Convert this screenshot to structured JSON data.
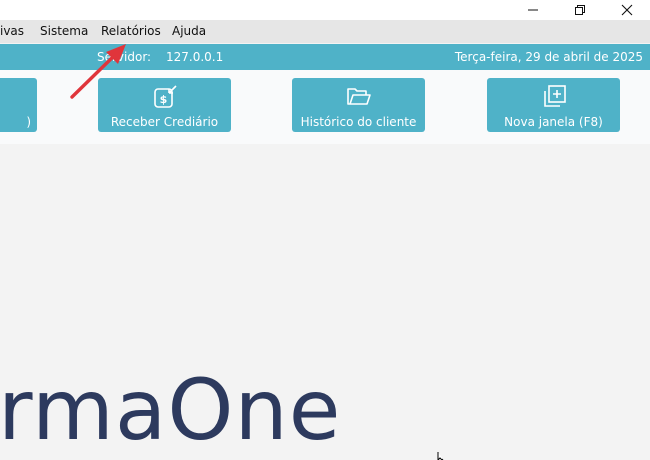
{
  "window": {
    "controls": [
      {
        "name": "minimize",
        "glyph": "—"
      },
      {
        "name": "maximize",
        "glyph": "❐"
      },
      {
        "name": "close",
        "glyph": "✕"
      }
    ]
  },
  "menubar": {
    "items": [
      {
        "label": "ivas"
      },
      {
        "label": "Sistema"
      },
      {
        "label": "Relatórios"
      },
      {
        "label": "Ajuda"
      }
    ]
  },
  "status": {
    "server_label": "Servidor:",
    "server_value": "127.0.0.1",
    "date": "Terça-feira, 29 de abril de 2025"
  },
  "toolbar": {
    "buttons": [
      {
        "label": ")",
        "icon": "unknown-icon"
      },
      {
        "label": "Receber Crediário",
        "icon": "receive-money-icon"
      },
      {
        "label": "Histórico do cliente",
        "icon": "folder-open-icon"
      },
      {
        "label": "Nova janela (F8)",
        "icon": "new-window-icon"
      }
    ]
  },
  "brand": {
    "text": "rmaOne"
  },
  "colors": {
    "accent": "#4fb2c8",
    "brand_text": "#2d3a5e",
    "annotation_arrow": "#e0353b"
  }
}
